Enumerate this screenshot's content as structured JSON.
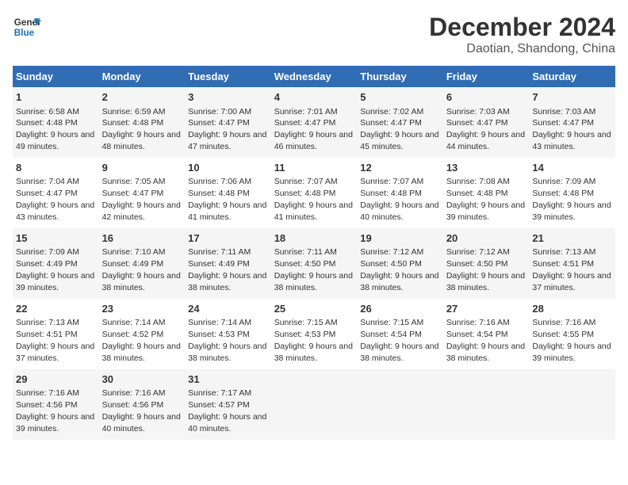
{
  "header": {
    "logo_line1": "General",
    "logo_line2": "Blue",
    "title": "December 2024",
    "subtitle": "Daotian, Shandong, China"
  },
  "days_of_week": [
    "Sunday",
    "Monday",
    "Tuesday",
    "Wednesday",
    "Thursday",
    "Friday",
    "Saturday"
  ],
  "weeks": [
    [
      {
        "day": "1",
        "sunrise": "6:58 AM",
        "sunset": "4:48 PM",
        "daylight": "9 hours and 49 minutes."
      },
      {
        "day": "2",
        "sunrise": "6:59 AM",
        "sunset": "4:48 PM",
        "daylight": "9 hours and 48 minutes."
      },
      {
        "day": "3",
        "sunrise": "7:00 AM",
        "sunset": "4:47 PM",
        "daylight": "9 hours and 47 minutes."
      },
      {
        "day": "4",
        "sunrise": "7:01 AM",
        "sunset": "4:47 PM",
        "daylight": "9 hours and 46 minutes."
      },
      {
        "day": "5",
        "sunrise": "7:02 AM",
        "sunset": "4:47 PM",
        "daylight": "9 hours and 45 minutes."
      },
      {
        "day": "6",
        "sunrise": "7:03 AM",
        "sunset": "4:47 PM",
        "daylight": "9 hours and 44 minutes."
      },
      {
        "day": "7",
        "sunrise": "7:03 AM",
        "sunset": "4:47 PM",
        "daylight": "9 hours and 43 minutes."
      }
    ],
    [
      {
        "day": "8",
        "sunrise": "7:04 AM",
        "sunset": "4:47 PM",
        "daylight": "9 hours and 43 minutes."
      },
      {
        "day": "9",
        "sunrise": "7:05 AM",
        "sunset": "4:47 PM",
        "daylight": "9 hours and 42 minutes."
      },
      {
        "day": "10",
        "sunrise": "7:06 AM",
        "sunset": "4:48 PM",
        "daylight": "9 hours and 41 minutes."
      },
      {
        "day": "11",
        "sunrise": "7:07 AM",
        "sunset": "4:48 PM",
        "daylight": "9 hours and 41 minutes."
      },
      {
        "day": "12",
        "sunrise": "7:07 AM",
        "sunset": "4:48 PM",
        "daylight": "9 hours and 40 minutes."
      },
      {
        "day": "13",
        "sunrise": "7:08 AM",
        "sunset": "4:48 PM",
        "daylight": "9 hours and 39 minutes."
      },
      {
        "day": "14",
        "sunrise": "7:09 AM",
        "sunset": "4:48 PM",
        "daylight": "9 hours and 39 minutes."
      }
    ],
    [
      {
        "day": "15",
        "sunrise": "7:09 AM",
        "sunset": "4:49 PM",
        "daylight": "9 hours and 39 minutes."
      },
      {
        "day": "16",
        "sunrise": "7:10 AM",
        "sunset": "4:49 PM",
        "daylight": "9 hours and 38 minutes."
      },
      {
        "day": "17",
        "sunrise": "7:11 AM",
        "sunset": "4:49 PM",
        "daylight": "9 hours and 38 minutes."
      },
      {
        "day": "18",
        "sunrise": "7:11 AM",
        "sunset": "4:50 PM",
        "daylight": "9 hours and 38 minutes."
      },
      {
        "day": "19",
        "sunrise": "7:12 AM",
        "sunset": "4:50 PM",
        "daylight": "9 hours and 38 minutes."
      },
      {
        "day": "20",
        "sunrise": "7:12 AM",
        "sunset": "4:50 PM",
        "daylight": "9 hours and 38 minutes."
      },
      {
        "day": "21",
        "sunrise": "7:13 AM",
        "sunset": "4:51 PM",
        "daylight": "9 hours and 37 minutes."
      }
    ],
    [
      {
        "day": "22",
        "sunrise": "7:13 AM",
        "sunset": "4:51 PM",
        "daylight": "9 hours and 37 minutes."
      },
      {
        "day": "23",
        "sunrise": "7:14 AM",
        "sunset": "4:52 PM",
        "daylight": "9 hours and 38 minutes."
      },
      {
        "day": "24",
        "sunrise": "7:14 AM",
        "sunset": "4:53 PM",
        "daylight": "9 hours and 38 minutes."
      },
      {
        "day": "25",
        "sunrise": "7:15 AM",
        "sunset": "4:53 PM",
        "daylight": "9 hours and 38 minutes."
      },
      {
        "day": "26",
        "sunrise": "7:15 AM",
        "sunset": "4:54 PM",
        "daylight": "9 hours and 38 minutes."
      },
      {
        "day": "27",
        "sunrise": "7:16 AM",
        "sunset": "4:54 PM",
        "daylight": "9 hours and 38 minutes."
      },
      {
        "day": "28",
        "sunrise": "7:16 AM",
        "sunset": "4:55 PM",
        "daylight": "9 hours and 39 minutes."
      }
    ],
    [
      {
        "day": "29",
        "sunrise": "7:16 AM",
        "sunset": "4:56 PM",
        "daylight": "9 hours and 39 minutes."
      },
      {
        "day": "30",
        "sunrise": "7:16 AM",
        "sunset": "4:56 PM",
        "daylight": "9 hours and 40 minutes."
      },
      {
        "day": "31",
        "sunrise": "7:17 AM",
        "sunset": "4:57 PM",
        "daylight": "9 hours and 40 minutes."
      },
      null,
      null,
      null,
      null
    ]
  ]
}
